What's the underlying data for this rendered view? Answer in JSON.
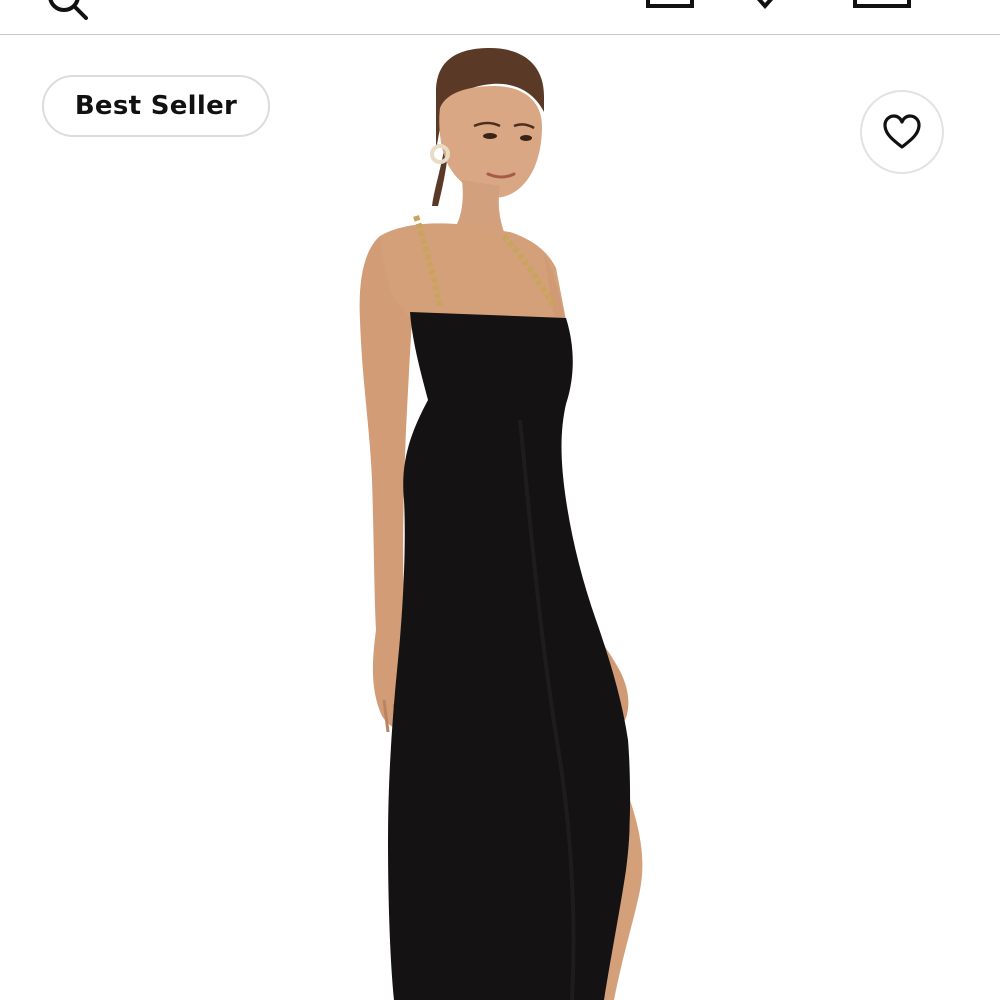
{
  "header": {
    "icons": [
      "search-icon",
      "account-icon",
      "heart-icon",
      "bag-icon"
    ]
  },
  "product": {
    "badge_label": "Best Seller",
    "favorite_icon": "heart-outline-icon",
    "image_subject": "product-photo"
  },
  "colors": {
    "background": "#ffffff",
    "badge_border": "#dcdcdc",
    "dress": "#141212",
    "skin": "#d4a07a",
    "hair": "#5a3a26",
    "chain": "#c9a45c"
  }
}
